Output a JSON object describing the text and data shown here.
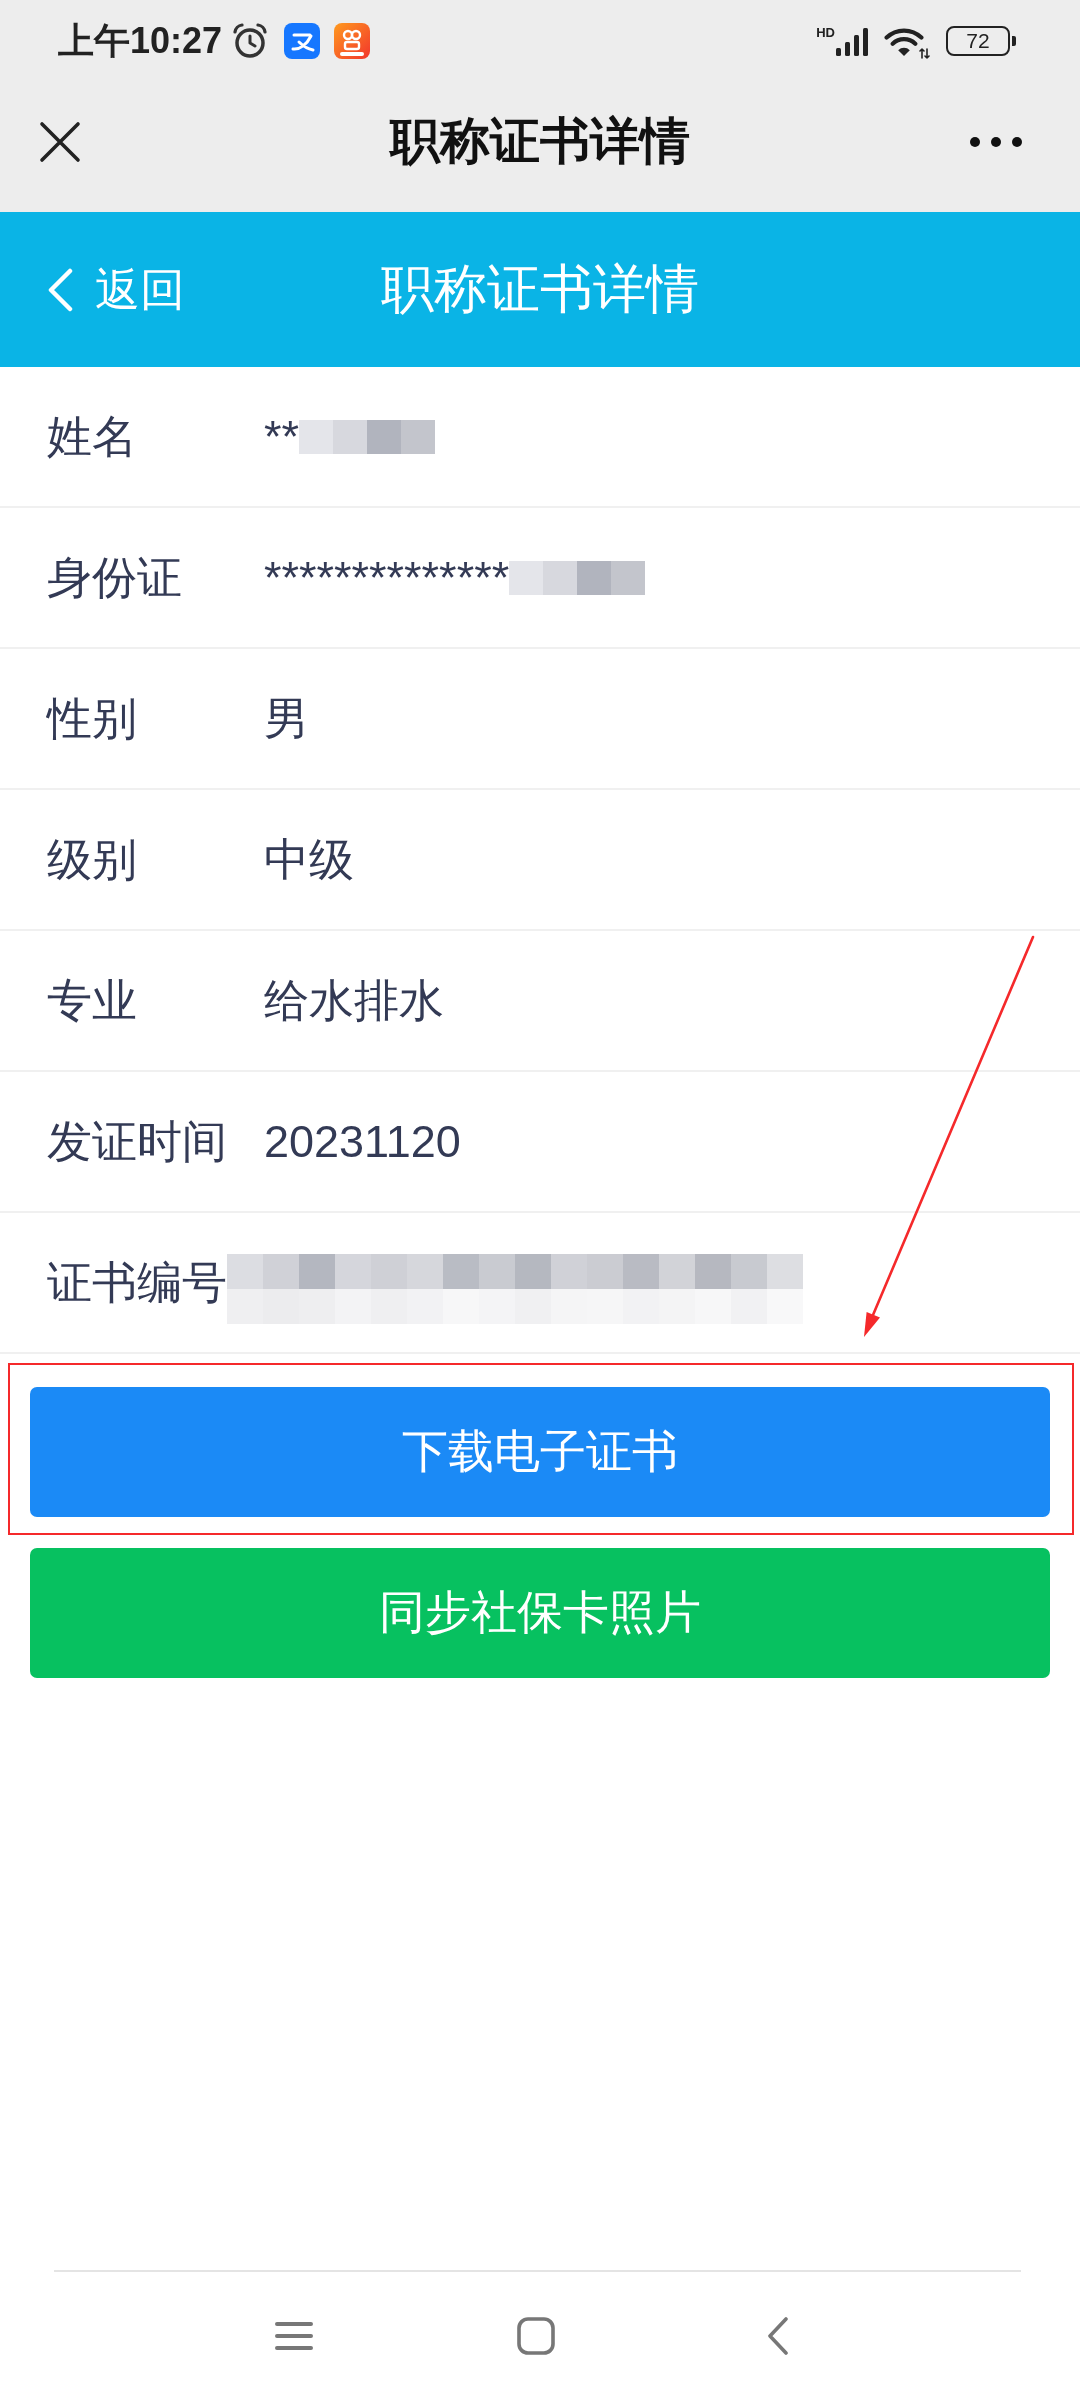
{
  "status_bar": {
    "time": "上午10:27",
    "network": "HD",
    "battery": "72"
  },
  "app_bar": {
    "title": "职称证书详情"
  },
  "nav_header": {
    "back_label": "返回",
    "title": "职称证书详情"
  },
  "details": [
    {
      "label": "姓名",
      "value": "**",
      "redacted": true
    },
    {
      "label": "身份证",
      "value": "**************",
      "redacted": true
    },
    {
      "label": "性别",
      "value": "男",
      "redacted": false
    },
    {
      "label": "级别",
      "value": "中级",
      "redacted": false
    },
    {
      "label": "专业",
      "value": "给水排水",
      "redacted": false
    },
    {
      "label": "发证时间",
      "value": "20231120",
      "redacted": false
    },
    {
      "label": "证书编号",
      "redacted": true
    }
  ],
  "buttons": [
    {
      "label": "下载电子证书",
      "kind": "primary",
      "highlighted": true
    },
    {
      "label": "同步社保卡照片",
      "kind": "success",
      "highlighted": false
    }
  ]
}
